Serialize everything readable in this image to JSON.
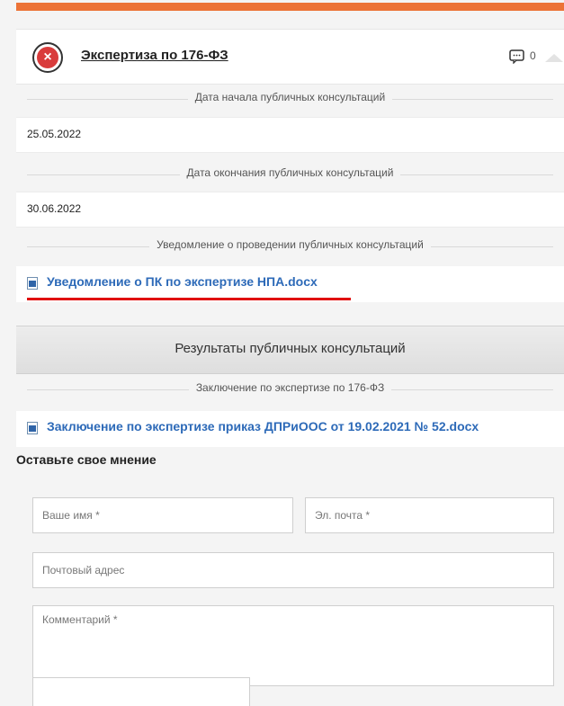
{
  "card": {
    "title": "Экспертиза по 176-ФЗ",
    "comment_count": "0",
    "accent_color": "#ec7337",
    "status_icon": "close-icon"
  },
  "sections": {
    "start_date_label": "Дата начала публичных консультаций",
    "start_date_value": "25.05.2022",
    "end_date_label": "Дата окончания публичных консультаций",
    "end_date_value": "30.06.2022",
    "notice_label": "Уведомление о проведении публичных консультаций",
    "notice_file": "Уведомление о ПК по экспертизе НПА.docx",
    "results_title": "Результаты публичных консультаций",
    "conclusion_label": "Заключение по экспертизе по 176-ФЗ",
    "conclusion_file": "Заключение по экспертизе приказ ДПРиООС от 19.02.2021 № 52.docx"
  },
  "form": {
    "title": "Оставьте свое мнение",
    "name_placeholder": "Ваше имя *",
    "email_placeholder": "Эл. почта *",
    "address_placeholder": "Почтовый адрес",
    "comment_placeholder": "Комментарий *"
  },
  "colors": {
    "link": "#2d6ab8",
    "highlight": "#e01010",
    "error_icon": "#d93c3c"
  }
}
